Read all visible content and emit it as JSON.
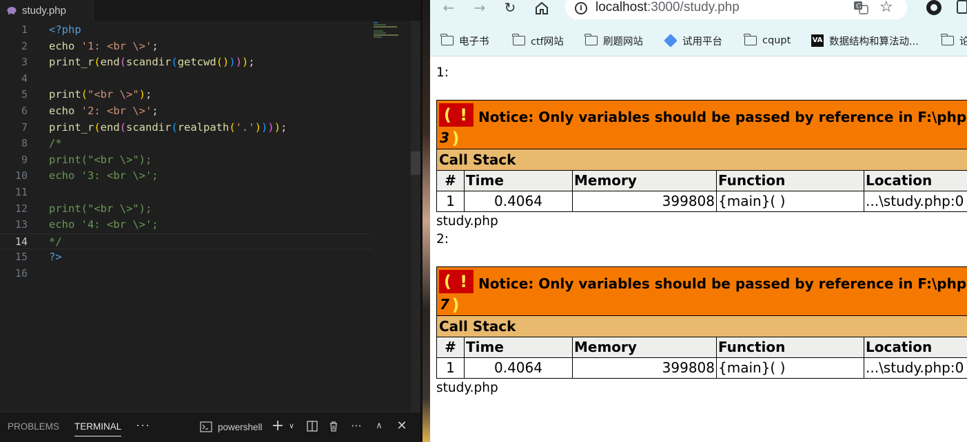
{
  "editor": {
    "tab_label": "study.php",
    "lines": [
      {
        "n": "1",
        "tokens": [
          {
            "c": "t-tag",
            "t": "<?php"
          }
        ]
      },
      {
        "n": "2",
        "tokens": [
          {
            "c": "t-kw",
            "t": "echo"
          },
          {
            "c": "t-pl",
            "t": " "
          },
          {
            "c": "t-str",
            "t": "'1: <br \\>'"
          },
          {
            "c": "t-pl",
            "t": ";"
          }
        ]
      },
      {
        "n": "3",
        "tokens": [
          {
            "c": "t-fn",
            "t": "print_r"
          },
          {
            "c": "t-b1",
            "t": "("
          },
          {
            "c": "t-fn",
            "t": "end"
          },
          {
            "c": "t-b2",
            "t": "("
          },
          {
            "c": "t-fn",
            "t": "scandir"
          },
          {
            "c": "t-b3",
            "t": "("
          },
          {
            "c": "t-fn",
            "t": "getcwd"
          },
          {
            "c": "t-b1",
            "t": "()"
          },
          {
            "c": "t-b3",
            "t": ")"
          },
          {
            "c": "t-b2",
            "t": ")"
          },
          {
            "c": "t-b1",
            "t": ")"
          },
          {
            "c": "t-pl",
            "t": ";"
          }
        ]
      },
      {
        "n": "4",
        "tokens": []
      },
      {
        "n": "5",
        "tokens": [
          {
            "c": "t-fn",
            "t": "print"
          },
          {
            "c": "t-b1",
            "t": "("
          },
          {
            "c": "t-str",
            "t": "\"<br \\>\""
          },
          {
            "c": "t-b1",
            "t": ")"
          },
          {
            "c": "t-pl",
            "t": ";"
          }
        ]
      },
      {
        "n": "6",
        "tokens": [
          {
            "c": "t-kw",
            "t": "echo"
          },
          {
            "c": "t-pl",
            "t": " "
          },
          {
            "c": "t-str",
            "t": "'2: <br \\>'"
          },
          {
            "c": "t-pl",
            "t": ";"
          }
        ]
      },
      {
        "n": "7",
        "tokens": [
          {
            "c": "t-fn",
            "t": "print_r"
          },
          {
            "c": "t-b1",
            "t": "("
          },
          {
            "c": "t-fn",
            "t": "end"
          },
          {
            "c": "t-b2",
            "t": "("
          },
          {
            "c": "t-fn",
            "t": "scandir"
          },
          {
            "c": "t-b3",
            "t": "("
          },
          {
            "c": "t-fn",
            "t": "realpath"
          },
          {
            "c": "t-b1",
            "t": "("
          },
          {
            "c": "t-str",
            "t": "'.'"
          },
          {
            "c": "t-b1",
            "t": ")"
          },
          {
            "c": "t-b3",
            "t": ")"
          },
          {
            "c": "t-b2",
            "t": ")"
          },
          {
            "c": "t-b1",
            "t": ")"
          },
          {
            "c": "t-pl",
            "t": ";"
          }
        ]
      },
      {
        "n": "8",
        "tokens": [
          {
            "c": "t-com",
            "t": "/*"
          }
        ]
      },
      {
        "n": "9",
        "tokens": [
          {
            "c": "t-com",
            "t": "print(\"<br \\>\");"
          }
        ]
      },
      {
        "n": "10",
        "tokens": [
          {
            "c": "t-com",
            "t": "echo '3: <br \\>';"
          }
        ]
      },
      {
        "n": "11",
        "tokens": []
      },
      {
        "n": "12",
        "tokens": [
          {
            "c": "t-com",
            "t": "print(\"<br \\>\");"
          }
        ]
      },
      {
        "n": "13",
        "tokens": [
          {
            "c": "t-com",
            "t": "echo '4: <br \\>';"
          }
        ]
      },
      {
        "n": "14",
        "tokens": [
          {
            "c": "t-com",
            "t": "*/"
          }
        ]
      },
      {
        "n": "15",
        "tokens": [
          {
            "c": "t-tag",
            "t": "?>"
          }
        ]
      },
      {
        "n": "16",
        "tokens": []
      }
    ],
    "active_line": "14"
  },
  "panel": {
    "problems_label": "PROBLEMS",
    "terminal_label": "TERMINAL",
    "more_label": "···",
    "shell_label": "powershell"
  },
  "browser": {
    "url_host": "localhost",
    "url_path": ":3000/study.php",
    "bookmarks": [
      {
        "label": "电子书",
        "icon": "folder-icon"
      },
      {
        "label": "ctf网站",
        "icon": "folder-icon"
      },
      {
        "label": "刷题网站",
        "icon": "folder-icon"
      },
      {
        "label": "试用平台",
        "icon": "diamond-icon"
      },
      {
        "label": "cqupt",
        "icon": "folder-icon"
      },
      {
        "label": "数据结构和算法动...",
        "icon": "va-logo-icon"
      },
      {
        "label": "论",
        "icon": "folder-icon"
      }
    ]
  },
  "page": {
    "out1": "1:",
    "out2": "study.php",
    "out3": "2:",
    "out4": "study.php",
    "notices": [
      {
        "bang": "( ! )",
        "message": "Notice: Only variables should be passed by reference in F:\\php code\\study.php on line",
        "line": "3",
        "callstack_title": "Call Stack",
        "headers": [
          "#",
          "Time",
          "Memory",
          "Function",
          "Location"
        ],
        "row": [
          "1",
          "0.4064",
          "399808",
          "{main}( )",
          "...\\study.php:0"
        ]
      },
      {
        "bang": "( ! )",
        "message": "Notice: Only variables should be passed by reference in F:\\php code\\study.php on line",
        "line": "7",
        "callstack_title": "Call Stack",
        "headers": [
          "#",
          "Time",
          "Memory",
          "Function",
          "Location"
        ],
        "row": [
          "1",
          "0.4064",
          "399808",
          "{main}( )",
          "...\\study.php:0"
        ]
      }
    ]
  },
  "colors": {
    "notice_bg": "#f57900",
    "bang_bg": "#cc0000",
    "callstack_bg": "#e9b96e",
    "browser_chrome": "#e6f6f8"
  }
}
